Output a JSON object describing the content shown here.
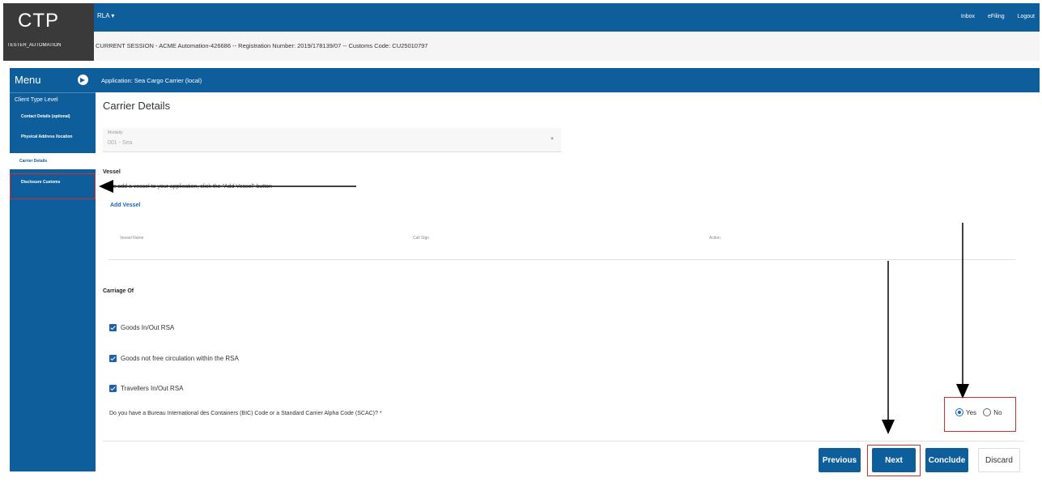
{
  "app": {
    "logo": "CTP",
    "user": "TESTER_AUTOMATION",
    "menu_label": "RLA ▾",
    "links": [
      "Inbox",
      "eFiling",
      "Logout"
    ],
    "session": "CURRENT SESSION - ACME Automation-426686 -- Registration Number: 2019/178139/07 -- Customs Code: CU25010797"
  },
  "sidebar": {
    "title": "Menu",
    "level": "Client Type Level",
    "items": [
      {
        "label": "Contact Details (optional)"
      },
      {
        "label": "Physical Address /location"
      },
      {
        "label": "Carrier Details"
      },
      {
        "label": "Disclosure Customs"
      }
    ]
  },
  "main": {
    "header": "Application: Sea Cargo Carrier (local)",
    "title": "Carrier Details",
    "modality": {
      "label": "Modality",
      "value": "001 - Sea"
    },
    "vessel": {
      "title": "Vessel",
      "hint": "To add a vessel to your application, click the \"Add Vessel\" button",
      "add_label": "Add Vessel",
      "columns": [
        "Vessel Name",
        "Call Sign",
        "Action"
      ]
    },
    "carriage": {
      "title": "Carriage Of",
      "options": [
        "Goods In/Out RSA",
        "Goods not free circulation within the RSA",
        "Travellers In/Out RSA"
      ]
    },
    "question": "Do you have a Bureau International des Containers (BIC) Code or a Standard Carrier Alpha Code (SCAC)? *",
    "radio": {
      "yes": "Yes",
      "no": "No",
      "selected": "Yes"
    }
  },
  "buttons": {
    "previous": "Previous",
    "next": "Next",
    "conclude": "Conclude",
    "discard": "Discard"
  },
  "colors": {
    "primary": "#0d5e9a",
    "annotation": "#d32f2f"
  }
}
